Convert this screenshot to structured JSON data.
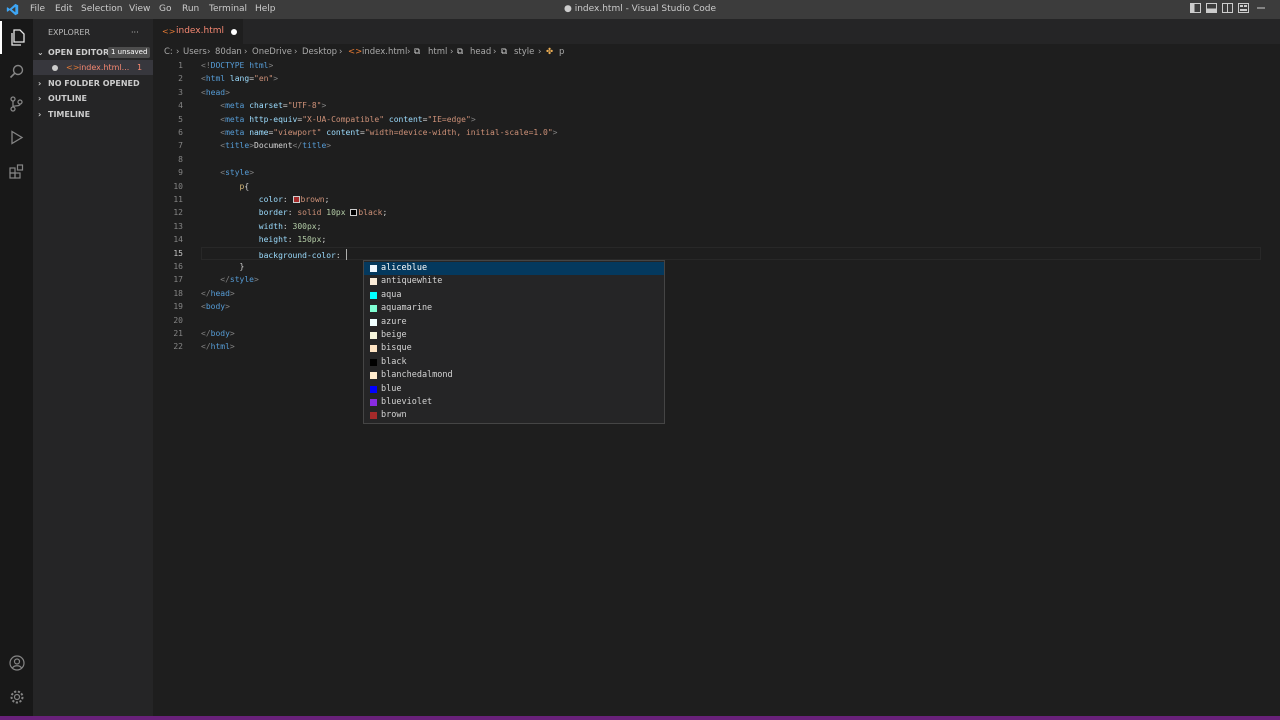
{
  "titlebar": {
    "menus": [
      "File",
      "Edit",
      "Selection",
      "View",
      "Go",
      "Run",
      "Terminal",
      "Help"
    ],
    "window_title": "● index.html - Visual Studio Code"
  },
  "sidebar": {
    "header": "EXPLORER",
    "more": "···",
    "open_editors": {
      "label": "OPEN EDITORS",
      "badge": "1 unsaved"
    },
    "open_file": {
      "name": "index.html...",
      "problems": "1"
    },
    "sections": [
      "NO FOLDER OPENED",
      "OUTLINE",
      "TIMELINE"
    ]
  },
  "tab": {
    "name": "index.html"
  },
  "breadcrumb": {
    "parts": [
      "C:",
      "Users",
      "80dan",
      "OneDrive",
      "Desktop",
      "index.html",
      "html",
      "head",
      "style",
      "p"
    ]
  },
  "editor": {
    "current_line": 15,
    "lines": [
      {
        "n": "1",
        "t": "<!DOCTYPE html>"
      },
      {
        "n": "2",
        "t": "<html lang=\"en\">"
      },
      {
        "n": "3",
        "t": "<head>"
      },
      {
        "n": "4",
        "t": "    <meta charset=\"UTF-8\">"
      },
      {
        "n": "5",
        "t": "    <meta http-equiv=\"X-UA-Compatible\" content=\"IE=edge\">"
      },
      {
        "n": "6",
        "t": "    <meta name=\"viewport\" content=\"width=device-width, initial-scale=1.0\">"
      },
      {
        "n": "7",
        "t": "    <title>Document</title>"
      },
      {
        "n": "8",
        "t": ""
      },
      {
        "n": "9",
        "t": "    <style>"
      },
      {
        "n": "10",
        "t": "        p{"
      },
      {
        "n": "11",
        "t": "            color: brown;"
      },
      {
        "n": "12",
        "t": "            border: solid 10px black;"
      },
      {
        "n": "13",
        "t": "            width: 300px;"
      },
      {
        "n": "14",
        "t": "            height: 150px;"
      },
      {
        "n": "15",
        "t": "            background-color: "
      },
      {
        "n": "16",
        "t": "        }"
      },
      {
        "n": "17",
        "t": "    </style>"
      },
      {
        "n": "18",
        "t": "</head>"
      },
      {
        "n": "19",
        "t": "<body>"
      },
      {
        "n": "20",
        "t": ""
      },
      {
        "n": "21",
        "t": "</body>"
      },
      {
        "n": "22",
        "t": "</html>"
      }
    ]
  },
  "suggest": {
    "selected": 0,
    "items": [
      {
        "label": "aliceblue",
        "color": "#f0f8ff"
      },
      {
        "label": "antiquewhite",
        "color": "#faebd7"
      },
      {
        "label": "aqua",
        "color": "#00ffff"
      },
      {
        "label": "aquamarine",
        "color": "#7fffd4"
      },
      {
        "label": "azure",
        "color": "#f0ffff"
      },
      {
        "label": "beige",
        "color": "#f5f5dc"
      },
      {
        "label": "bisque",
        "color": "#ffe4c4"
      },
      {
        "label": "black",
        "color": "#000000"
      },
      {
        "label": "blanchedalmond",
        "color": "#ffebcd"
      },
      {
        "label": "blue",
        "color": "#0000ff"
      },
      {
        "label": "blueviolet",
        "color": "#8a2be2"
      },
      {
        "label": "brown",
        "color": "#a52a2a"
      }
    ]
  },
  "colors": {
    "accent": "#007acc",
    "status_bar": "#68217a",
    "modified_file": "#f48771"
  }
}
